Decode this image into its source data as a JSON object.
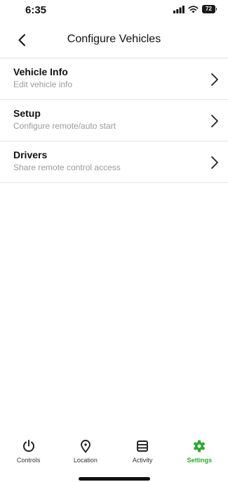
{
  "status_bar": {
    "time": "6:35",
    "battery": "72"
  },
  "header": {
    "title": "Configure Vehicles",
    "back_icon": "chevron-left-icon"
  },
  "list": {
    "items": [
      {
        "title": "Vehicle Info",
        "subtitle": "Edit vehicle info"
      },
      {
        "title": "Setup",
        "subtitle": "Configure remote/auto start"
      },
      {
        "title": "Drivers",
        "subtitle": "Share remote control access"
      }
    ]
  },
  "bottom_nav": {
    "items": [
      {
        "label": "Controls",
        "icon": "power-icon"
      },
      {
        "label": "Location",
        "icon": "location-pin-icon"
      },
      {
        "label": "Activity",
        "icon": "activity-list-icon"
      },
      {
        "label": "Settings",
        "icon": "gear-icon",
        "active": true
      }
    ]
  },
  "colors": {
    "accent": "#2fa82f",
    "subtitle": "#9a9a9a",
    "divider": "#e6e6e6"
  }
}
